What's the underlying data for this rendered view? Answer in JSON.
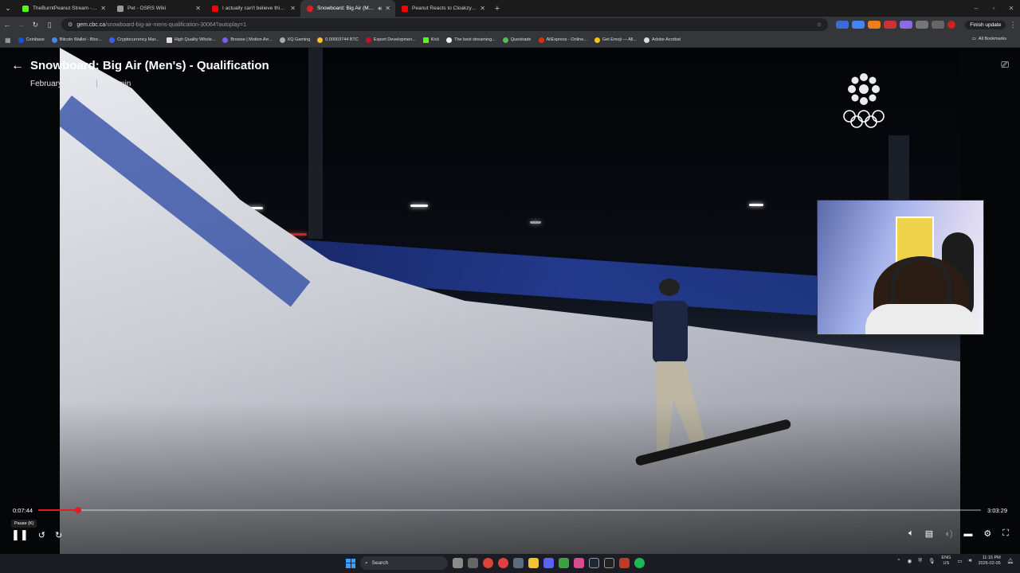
{
  "browser": {
    "tabs": [
      {
        "title": "TheBurntPeanut Stream - Watc",
        "color": "#53fc18"
      },
      {
        "title": "Pet - OSRS Wiki",
        "color": "#999999"
      },
      {
        "title": "I actually can't believe this.. - Y",
        "color": "#ff0000"
      },
      {
        "title": "Snowboard: Big Air (Men's)",
        "color": "#e31b23"
      },
      {
        "title": "Peanut Reacts to Cloakzy Slip U",
        "color": "#ff0000"
      }
    ],
    "url_domain": "gem.cbc.ca",
    "url_path": "/snowboard-big-air-mens-qualification-30064?autoplay=1",
    "finish_update": "Finish update",
    "bookmarks": [
      "Coinbase",
      "Bitcoin Wallet - Bloc...",
      "Cryptocurrency Mar...",
      "High Quality Whole...",
      "Browse | Motion Arr...",
      "XQ Gaming",
      "0.00003744 BTC",
      "Export Developmen...",
      "Kick",
      "The best streaming...",
      "Questrade",
      "AliExpress - Online...",
      "Get Emoji — All...",
      "Adobe Acrobat"
    ],
    "all_bookmarks": "All Bookmarks"
  },
  "video": {
    "title": "Snowboard: Big Air (Men's) - Qualification",
    "date": "February 5, 2026",
    "duration": "183 min",
    "current_time": "0:07:44",
    "total_time": "3:03:29",
    "progress_fraction": 0.042,
    "pause_tooltip": "Pause (K)"
  },
  "taskbar": {
    "search_placeholder": "Search",
    "lang_top": "ENG",
    "lang_bottom": "US",
    "time": "11:15 PM",
    "date": "2026-02-05"
  },
  "colors": {
    "accent": "#e31b23"
  }
}
